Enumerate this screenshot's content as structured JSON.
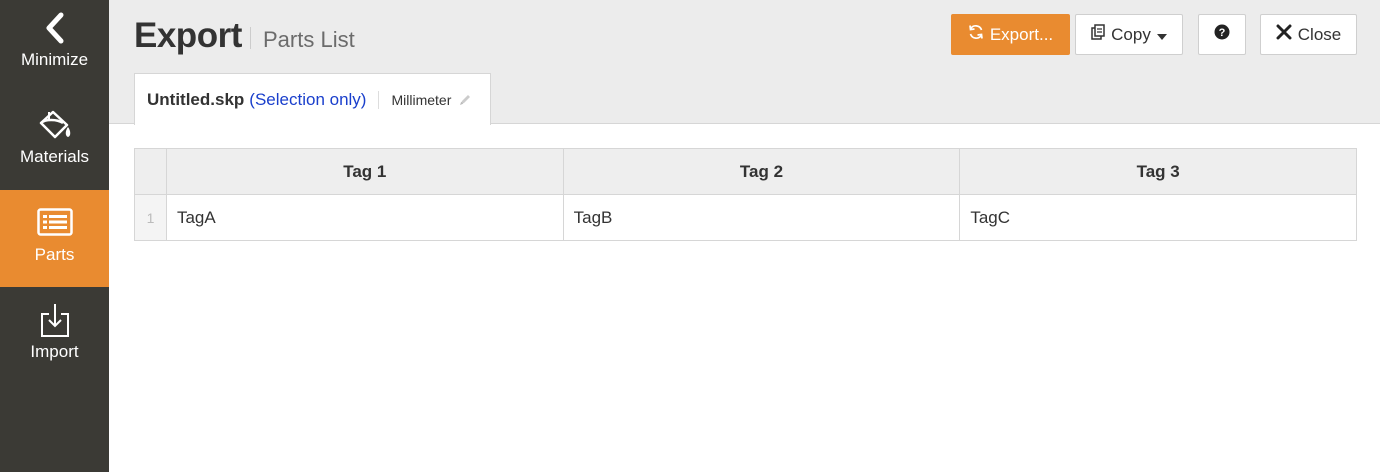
{
  "sidebar": {
    "items": [
      {
        "label": "Minimize",
        "icon": "chevron-left-icon"
      },
      {
        "label": "Materials",
        "icon": "paint-bucket-icon"
      },
      {
        "label": "Parts",
        "icon": "list-icon",
        "active": true
      },
      {
        "label": "Import",
        "icon": "import-icon"
      }
    ]
  },
  "header": {
    "title": "Export",
    "subtitle": "Parts List",
    "buttons": {
      "export_label": "Export...",
      "copy_label": "Copy",
      "close_label": "Close"
    }
  },
  "tab": {
    "file": "Untitled.skp",
    "selection": "(Selection only)",
    "unit": "Millimeter"
  },
  "table": {
    "columns": [
      "Tag 1",
      "Tag 2",
      "Tag 3"
    ],
    "rows": [
      {
        "num": "1",
        "cells": [
          "TagA",
          "TagB",
          "TagC"
        ]
      }
    ]
  },
  "colors": {
    "sidebar_bg": "#3b3a35",
    "accent": "#e98b30",
    "header_bg": "#ececec",
    "link_blue": "#1a3fcc"
  }
}
